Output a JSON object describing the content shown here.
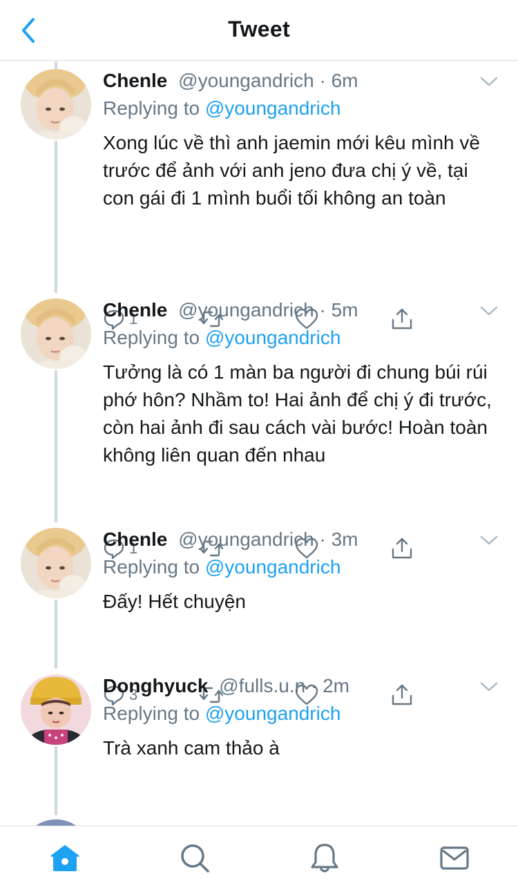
{
  "header": {
    "title": "Tweet",
    "back_icon": "chevron-left-icon"
  },
  "colors": {
    "accent": "#1da1f2",
    "secondary_text": "#657786",
    "primary_text": "#14171a",
    "divider": "#d8dde1",
    "thread_line": "#ccd6dd"
  },
  "tweets": [
    {
      "name": "Chenle",
      "handle": "@youngandrich",
      "sep": "·",
      "time": "6m",
      "reply_prefix": "Replying to",
      "reply_to": "@youngandrich",
      "text": "Xong lúc về thì anh jaemin mới kêu mình về trước để ảnh với anh jeno đưa chị ý về, tại con gái đi 1 mình buổi tối không an toàn",
      "reply_count": "1"
    },
    {
      "name": "Chenle",
      "handle": "@youngandrich",
      "sep": "·",
      "time": "5m",
      "reply_prefix": "Replying to",
      "reply_to": "@youngandrich",
      "text": "Tưởng là có 1 màn ba người đi chung búi rúi phớ hôn? Nhầm to! Hai ảnh để chị ý đi trước, còn hai ảnh đi sau cách vài bước! Hoàn toàn không liên quan đến nhau",
      "reply_count": "1"
    },
    {
      "name": "Chenle",
      "handle": "@youngandrich",
      "sep": "·",
      "time": "3m",
      "reply_prefix": "Replying to",
      "reply_to": "@youngandrich",
      "text": "Đấy! Hết chuyện",
      "reply_count": "3"
    },
    {
      "name": "Donghyuck",
      "handle": "@fulls.u.n",
      "sep": "·",
      "time": "2m",
      "reply_prefix": "Replying to",
      "reply_to": "@youngandrich",
      "text": "Trà xanh cam thảo à",
      "reply_count": ""
    }
  ],
  "action_icons": [
    "reply-icon",
    "retweet-icon",
    "like-icon",
    "share-icon"
  ],
  "tabbar": {
    "items": [
      "home-icon",
      "search-icon",
      "notifications-icon",
      "messages-icon"
    ],
    "active": "home-icon"
  }
}
